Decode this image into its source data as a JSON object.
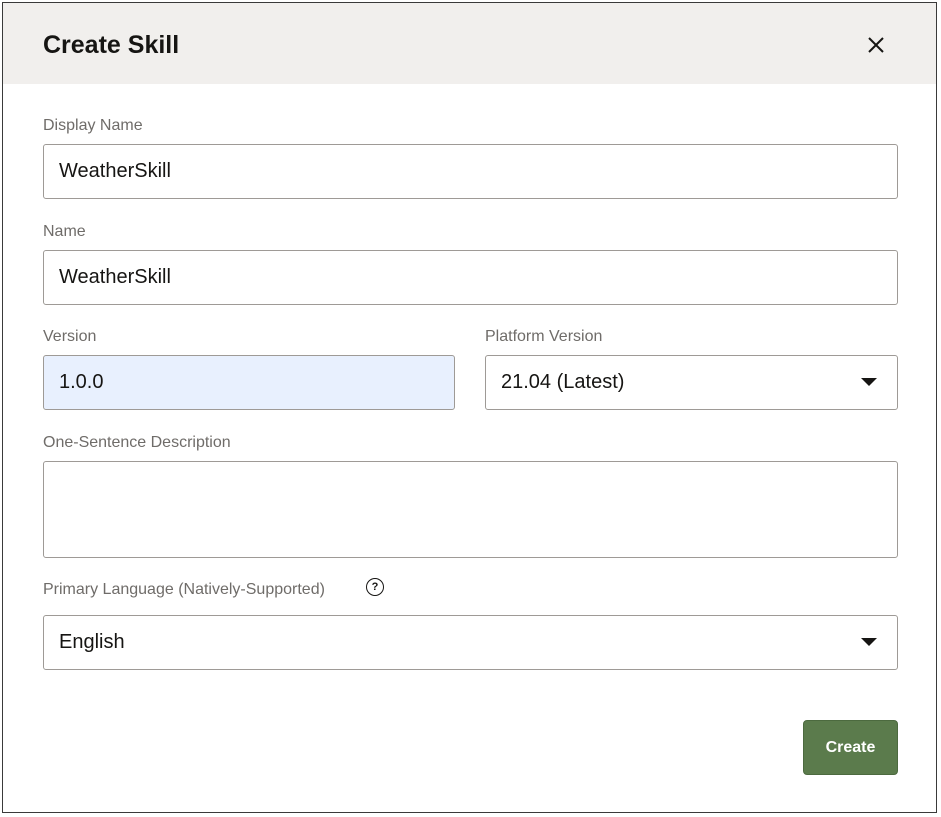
{
  "dialog": {
    "title": "Create Skill",
    "close_icon": "close-icon"
  },
  "fields": {
    "display_name": {
      "label": "Display Name",
      "value": "WeatherSkill"
    },
    "name": {
      "label": "Name",
      "value": "WeatherSkill"
    },
    "version": {
      "label": "Version",
      "value": "1.0.0"
    },
    "platform_version": {
      "label": "Platform Version",
      "value": "21.04 (Latest)"
    },
    "description": {
      "label": "One-Sentence Description",
      "value": ""
    },
    "primary_language": {
      "label": "Primary Language (Natively-Supported)",
      "value": "English",
      "help_icon": "help-icon"
    }
  },
  "actions": {
    "create_label": "Create"
  },
  "colors": {
    "header_bg": "#f1efed",
    "primary_button": "#5b7b4c",
    "autofill_bg": "#e8f0fe"
  }
}
